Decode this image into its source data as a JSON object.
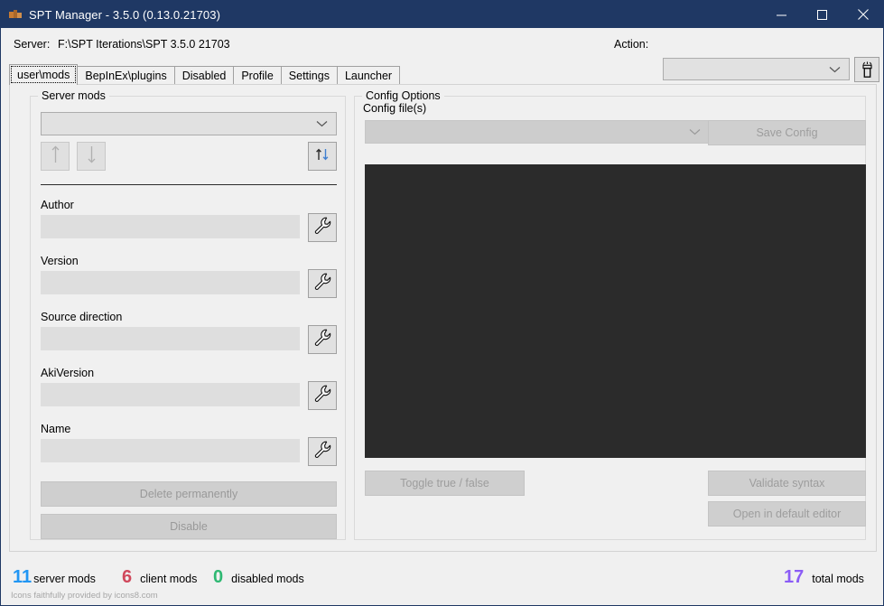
{
  "window": {
    "title": "SPT Manager - 3.5.0 (0.13.0.21703)",
    "icon": "app-icon",
    "minimize": "minimize-icon",
    "maximize": "maximize-icon",
    "close": "close-icon",
    "titlebar_color": "#1f3864"
  },
  "toolbar": {
    "server_label": "Server:",
    "server_path": "F:\\SPT Iterations\\SPT 3.5.0 21703",
    "action_label": "Action:",
    "action_value": "",
    "action_placeholder": "",
    "torch_button_icon": "flashlight-icon"
  },
  "tabs": [
    {
      "label": "user\\mods",
      "active": true
    },
    {
      "label": "BepInEx\\plugins",
      "active": false
    },
    {
      "label": "Disabled",
      "active": false
    },
    {
      "label": "Profile",
      "active": false
    },
    {
      "label": "Settings",
      "active": false
    },
    {
      "label": "Launcher",
      "active": false
    }
  ],
  "server_mods": {
    "group_title": "Server mods",
    "mods_combo_value": "",
    "move_up_icon": "arrow-up-icon",
    "move_down_icon": "arrow-down-icon",
    "sort_icon": "sort-updown-icon",
    "fields": [
      {
        "label": "Author",
        "value": "",
        "edit_icon": "wrench-icon"
      },
      {
        "label": "Version",
        "value": "",
        "edit_icon": "wrench-icon"
      },
      {
        "label": "Source direction",
        "value": "",
        "edit_icon": "wrench-icon"
      },
      {
        "label": "AkiVersion",
        "value": "",
        "edit_icon": "wrench-icon"
      },
      {
        "label": "Name",
        "value": "",
        "edit_icon": "wrench-icon"
      }
    ],
    "delete_label": "Delete permanently",
    "disable_label": "Disable"
  },
  "config_options": {
    "group_title": "Config Options",
    "config_files_label": "Config file(s)",
    "config_files_value": "",
    "save_config_label": "Save Config",
    "editor_content": "",
    "editor_bg": "#2b2b2b",
    "toggle_label": "Toggle true / false",
    "validate_label": "Validate syntax",
    "open_editor_label": "Open in default editor"
  },
  "status": {
    "server_mods": {
      "count": "11",
      "label": "server mods",
      "color": "#2196f3"
    },
    "client_mods": {
      "count": "6",
      "label": "client mods",
      "color": "#d0485c"
    },
    "disabled_mods": {
      "count": "0",
      "label": "disabled mods",
      "color": "#2eb872"
    },
    "total_mods": {
      "count": "17",
      "label": "total mods",
      "color": "#8b5cf6"
    },
    "credit": "Icons faithfully provided by icons8.com"
  }
}
